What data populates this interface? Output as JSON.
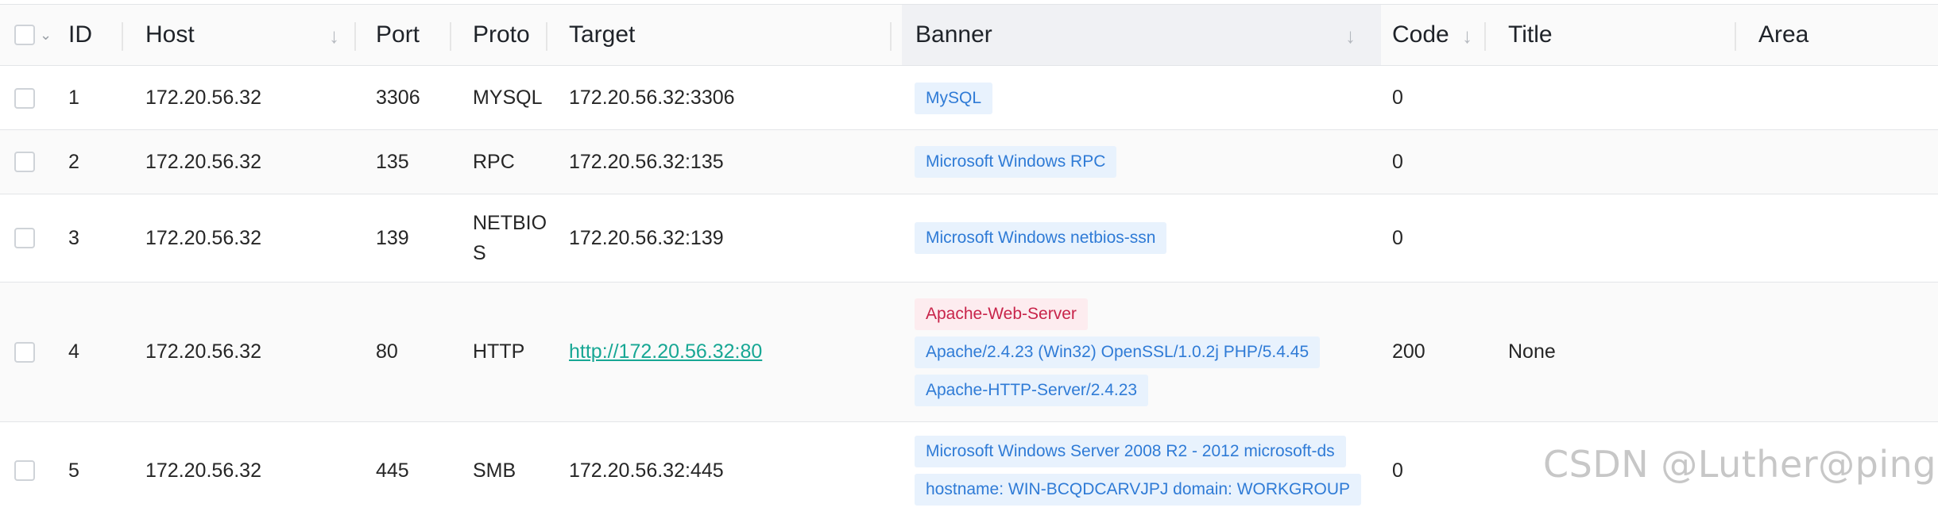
{
  "columns": {
    "id": "ID",
    "host": "Host",
    "port": "Port",
    "proto": "Proto",
    "target": "Target",
    "banner": "Banner",
    "code": "Code",
    "title": "Title",
    "area": "Area"
  },
  "rows": [
    {
      "id": "1",
      "host": "172.20.56.32",
      "port": "3306",
      "proto": "MYSQL",
      "target": "172.20.56.32:3306",
      "banners": [
        "MySQL"
      ],
      "code": "0",
      "title": ""
    },
    {
      "id": "2",
      "host": "172.20.56.32",
      "port": "135",
      "proto": "RPC",
      "target": "172.20.56.32:135",
      "banners": [
        "Microsoft Windows RPC"
      ],
      "code": "0",
      "title": ""
    },
    {
      "id": "3",
      "host": "172.20.56.32",
      "port": "139",
      "proto_line1": "NETBIO",
      "proto_line2": "S",
      "target": "172.20.56.32:139",
      "banners": [
        "Microsoft Windows netbios-ssn"
      ],
      "code": "0",
      "title": ""
    },
    {
      "id": "4",
      "host": "172.20.56.32",
      "port": "80",
      "proto": "HTTP",
      "target": "http://172.20.56.32:80",
      "banners": [
        "Apache-Web-Server",
        "Apache/2.4.23 (Win32) OpenSSL/1.0.2j PHP/5.4.45",
        "Apache-HTTP-Server/2.4.23"
      ],
      "code": "200",
      "title": "None"
    },
    {
      "id": "5",
      "host": "172.20.56.32",
      "port": "445",
      "proto": "SMB",
      "target": "172.20.56.32:445",
      "banners": [
        "Microsoft Windows Server 2008 R2 - 2012 microsoft-ds",
        "hostname: WIN-BCQDCARVJPJ domain: WORKGROUP"
      ],
      "code": "0",
      "title": ""
    }
  ],
  "watermark": "CSDN @Luther@ping",
  "icons": {
    "sort": "arrow-down-icon",
    "select": "chevron-down-icon"
  },
  "colors": {
    "tag_blue_bg": "#e8f2fd",
    "tag_blue_text": "#2f7bd6",
    "tag_red_bg": "#fdecef",
    "tag_red_text": "#c8244a",
    "link": "#17a794"
  }
}
